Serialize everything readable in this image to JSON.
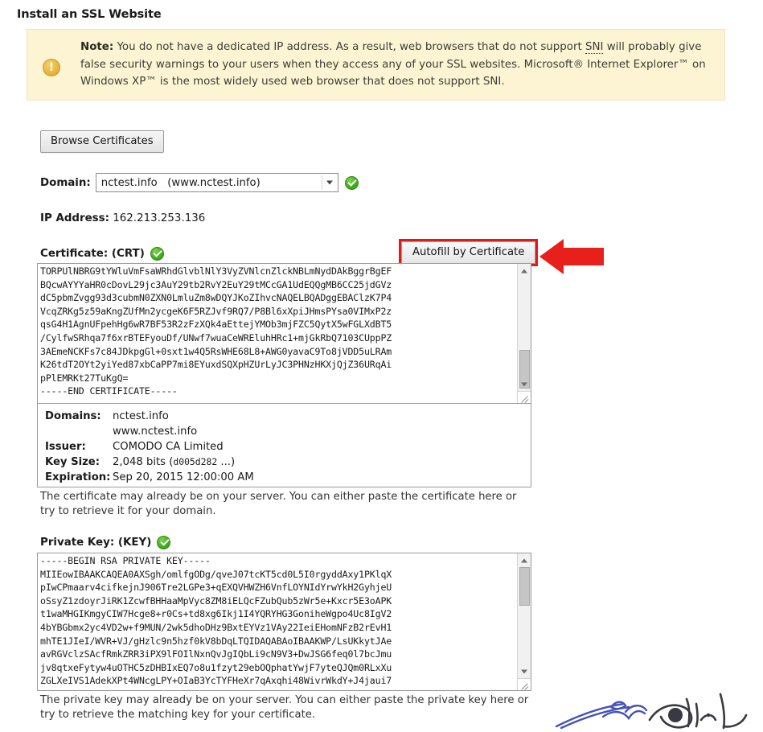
{
  "page": {
    "title": "Install an SSL Website"
  },
  "note": {
    "icon": "warning-exclamation-icon",
    "label": "Note:",
    "text_before_sni": " You do not have a dedicated IP address. As a result, web browsers that do not support ",
    "sni": "SNI",
    "text_after_sni": " will probably give false security warnings to your users when they access any of your SSL websites. Microsoft® Internet Explorer™ on Windows XP™ is the most widely used web browser that does not support SNI."
  },
  "buttons": {
    "browse_certificates": "Browse Certificates",
    "autofill_by_certificate": "Autofill by Certificate"
  },
  "domain": {
    "label": "Domain:",
    "selected": "nctest.info   (www.nctest.info)",
    "options": [
      "nctest.info   (www.nctest.info)"
    ],
    "status_icon": "green-check-icon"
  },
  "ip_address": {
    "label": "IP Address:",
    "value": "162.213.253.136"
  },
  "certificate": {
    "label": "Certificate: (CRT)",
    "status_icon": "green-check-icon",
    "textarea_value": "TORPUlNBRG9tYWluVmFsaWRhdGlvblNlY3VyZVNlcnZlckNBLmNydDAkBggrBgEF\nBQcwAYYYaHR0cDovL29jc3AuY29tb2RvY2EuY29tMCcGA1UdEQQgMB6CC25jdGVz\ndC5pbmZvgg93d3cubmN0ZXN0LmluZm8wDQYJKoZIhvcNAQELBQADggEBAClzK7P4\nVcqZRKg5z59aKngZUfMn2ycgeK6F5RZJvf9RQ7/P8Bl6xXpiJHmsPYsa0VIMxP2z\nqsG4H1AgnUFpehHg6wR7BF53R2zFzXQk4aEttejYMOb3mjFZC5QytX5wFGLXdBT5\n/CylfwSRhqa7f6xrBTEFyouDf/UNwf7wuaCeWREluhHRc1+mjGkRbQ7103CUppPZ\n3AEmeNCKFs7c84JDkpgGl+0sxt1w4Q5RsWHE68L8+AWG0yavaC9To8jVDD5uLRAm\nK26tdT2OYt2yiYed87xbCaPP7mi8EYuxdSQXpHZUrLyJC3PHNzHKXjQjZ36URqAi\npPlEMRKt27TuKgQ=\n-----END CERTIFICATE-----",
    "scrollbar": {
      "up_arrow_icon": "chevron-up-icon",
      "down_arrow_icon": "chevron-down-icon"
    },
    "helper_text": "The certificate may already be on your server. You can either paste the certificate here or try to retrieve it for your domain."
  },
  "certificate_details": {
    "rows": [
      {
        "label": "Domains:",
        "value": "nctest.info",
        "value2": "www.nctest.info"
      },
      {
        "label": "Issuer:",
        "value": "COMODO CA Limited"
      },
      {
        "label": "Key Size:",
        "value": "2,048 bits (",
        "mono": "d005d282",
        "value_tail": " ...)"
      },
      {
        "label": "Expiration:",
        "value": "Sep 20, 2015 12:00:00 AM"
      }
    ]
  },
  "private_key": {
    "label": "Private Key: (KEY)",
    "status_icon": "green-check-icon",
    "textarea_value": "-----BEGIN RSA PRIVATE KEY-----\nMIIEowIBAAKCAQEA0AXSgh/omlfgODg/qveJ07tcKT5cd0L5I0rgyddAxy1PKlqX\npIwCPmaarv4cifkejnJ906Tre2LGPe3+qEXQVHWZH6VnfLOYNIdYrwYkH2GyhjeU\noSsyZ1zdoyrJiRK1ZcwfBHHaaMpVyc8ZM8iELQcFZubQub5zWr5e+Kxcr5E3oAPK\nt1waMHGIKmgyCIW7Hcge8+r0Cs+td8xg6Ikj1I4YQRYHG3GoniheWgpo4Uc8IgV2\n4bYBGbmx2yc4VD2w+f9MUN/2wk5dhoDHz9BxtEYVz1VAy22IeiEHomNFzB2rEvH1\nmhTE1JIeI/WVR+VJ/gHzlc9n5hzf0kV8bDqLTQIDAQABAoIBAAKWP/LsUKkytJAe\navRGVclzSAcfRmkZRR3iPX9lFOIlNxnQvJgIQbLi9cN9V3+DwJSG6feq0l7bcJmu\njv8qtxeFytyw4uOTHC5zDHBIxEQ7o8u1fzyt29ebOQphatYwjF7yteQJQm0RLxXu\nZGLXeIVS1AdekXPt4WNcgLPY+OIaB3YcTYFHeXr7qAxqhi48WivrWkdY+J4jaui7",
    "scrollbar": {
      "up_arrow_icon": "chevron-up-icon",
      "down_arrow_icon": "chevron-down-icon"
    },
    "helper_text": "The private key may already be on your server. You can either paste the private key here or try to retrieve the matching key for your certificate."
  },
  "annotation": {
    "highlight_color": "#e01b17",
    "arrow_color": "#e8201c",
    "arrow_name": "red-pointer-arrow"
  },
  "watermark": {
    "name": "persian-calligraphy-watermark",
    "colors": [
      "#3b4bb5",
      "#2f2f3a"
    ]
  }
}
